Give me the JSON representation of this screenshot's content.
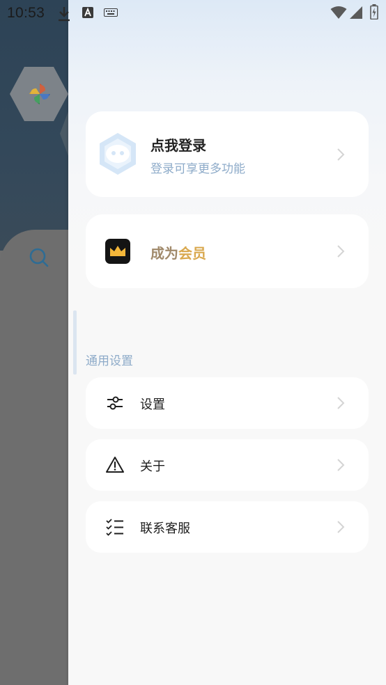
{
  "status_bar": {
    "time": "10:53",
    "icons": [
      "download-icon",
      "keyboard-a-icon",
      "keyboard-icon",
      "wifi-icon",
      "signal-icon",
      "battery-icon"
    ]
  },
  "background_app": {
    "icons": [
      "pinwheel-logo",
      "search-icon"
    ]
  },
  "drawer": {
    "login_card": {
      "title": "点我登录",
      "subtitle": "登录可享更多功能"
    },
    "vip_card": {
      "label_part1": "成为",
      "label_part2": "会员"
    },
    "section_title": "通用设置",
    "items": [
      {
        "label": "设置",
        "icon": "sliders-icon"
      },
      {
        "label": "关于",
        "icon": "warning-icon"
      },
      {
        "label": "联系客服",
        "icon": "checklist-icon"
      }
    ]
  },
  "colors": {
    "accent_blue": "#8eabc9",
    "vip_gold": "#d9a84e",
    "vip_brown": "#a0896a"
  }
}
